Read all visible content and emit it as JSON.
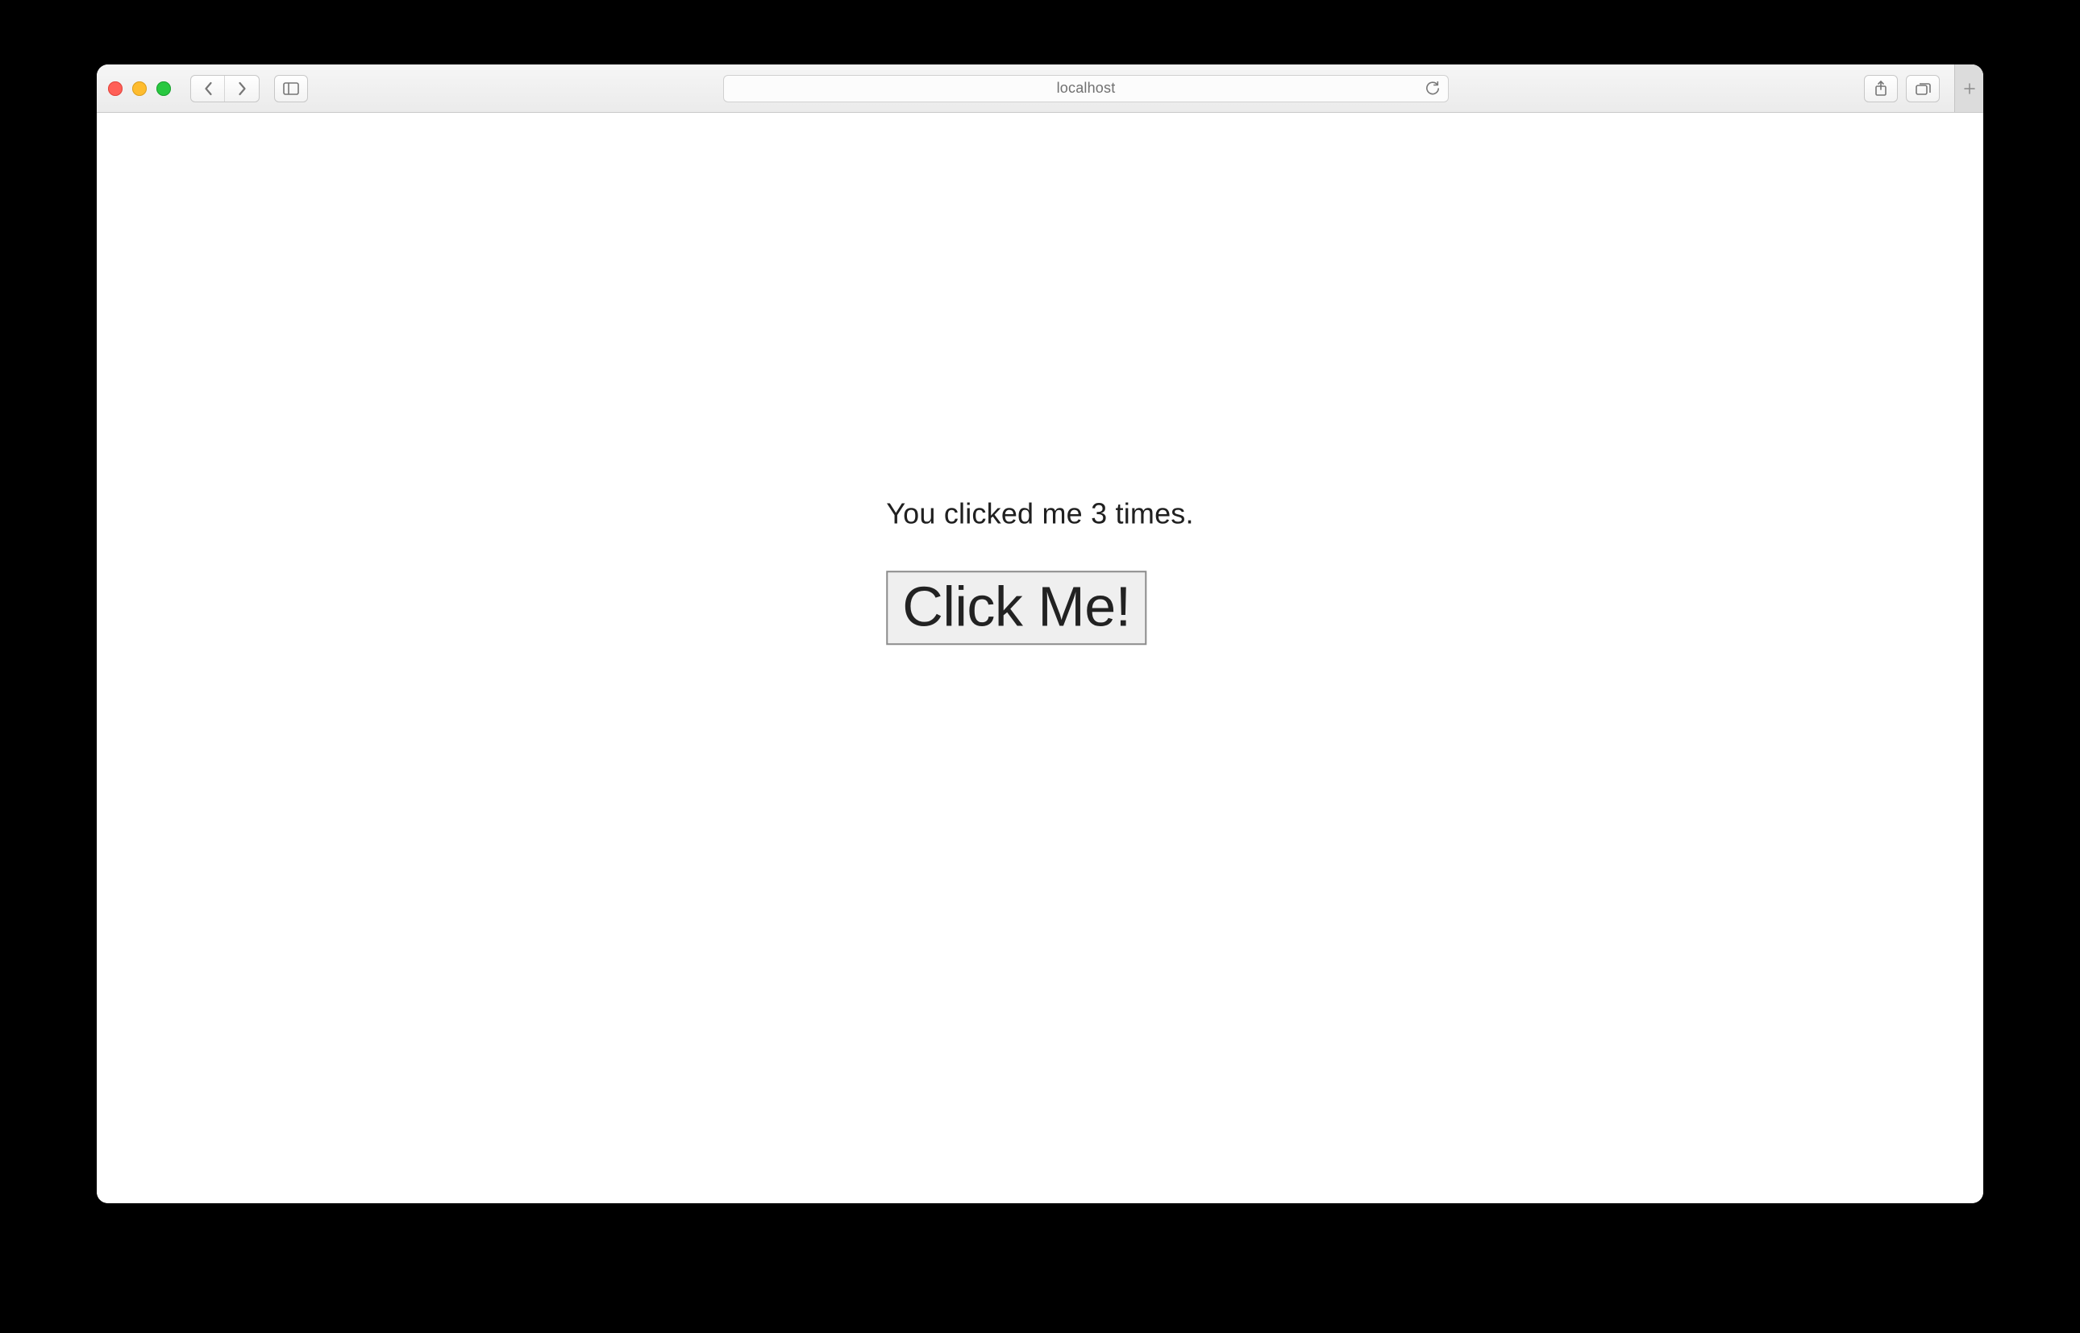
{
  "address": {
    "text": "localhost"
  },
  "page": {
    "status_text": "You clicked me 3 times.",
    "button_label": "Click Me!"
  }
}
